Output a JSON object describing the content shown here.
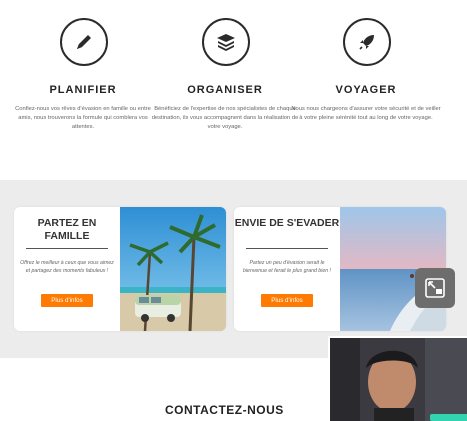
{
  "features": [
    {
      "title": "PLANIFIER",
      "icon": "pen-icon",
      "description": "Confiez-nous vos rêves d'évasion en famille ou entre amis, nous trouverons la formule qui comblera vos attentes."
    },
    {
      "title": "ORGANISER",
      "icon": "layers-icon",
      "description": "Bénéficiez de l'expertise de nos spécialistes de chaque destination, ils vous accompagnent dans la réalisation de votre voyage."
    },
    {
      "title": "VOYAGER",
      "icon": "rocket-icon",
      "description": "Nous nous chargeons d'assurer votre sécurité et de veiller à votre pleine sérénité tout au long de votre voyage."
    }
  ],
  "cards": [
    {
      "title": "PARTEZ EN FAMILLE",
      "description": "Offrez le meilleur à ceux que vous aimez et partagez des moments fabuleux !",
      "button": "Plus d'infos"
    },
    {
      "title": "ENVIE DE S'EVADER",
      "description": "Partez un peu d'évasion serait le bienvenue et ferait le plus grand bien !",
      "button": "Plus d'infos"
    }
  ],
  "contact_heading": "CONTACTEZ-NOUS",
  "colors": {
    "accent": "#ff7a00",
    "band": "#ececec"
  }
}
